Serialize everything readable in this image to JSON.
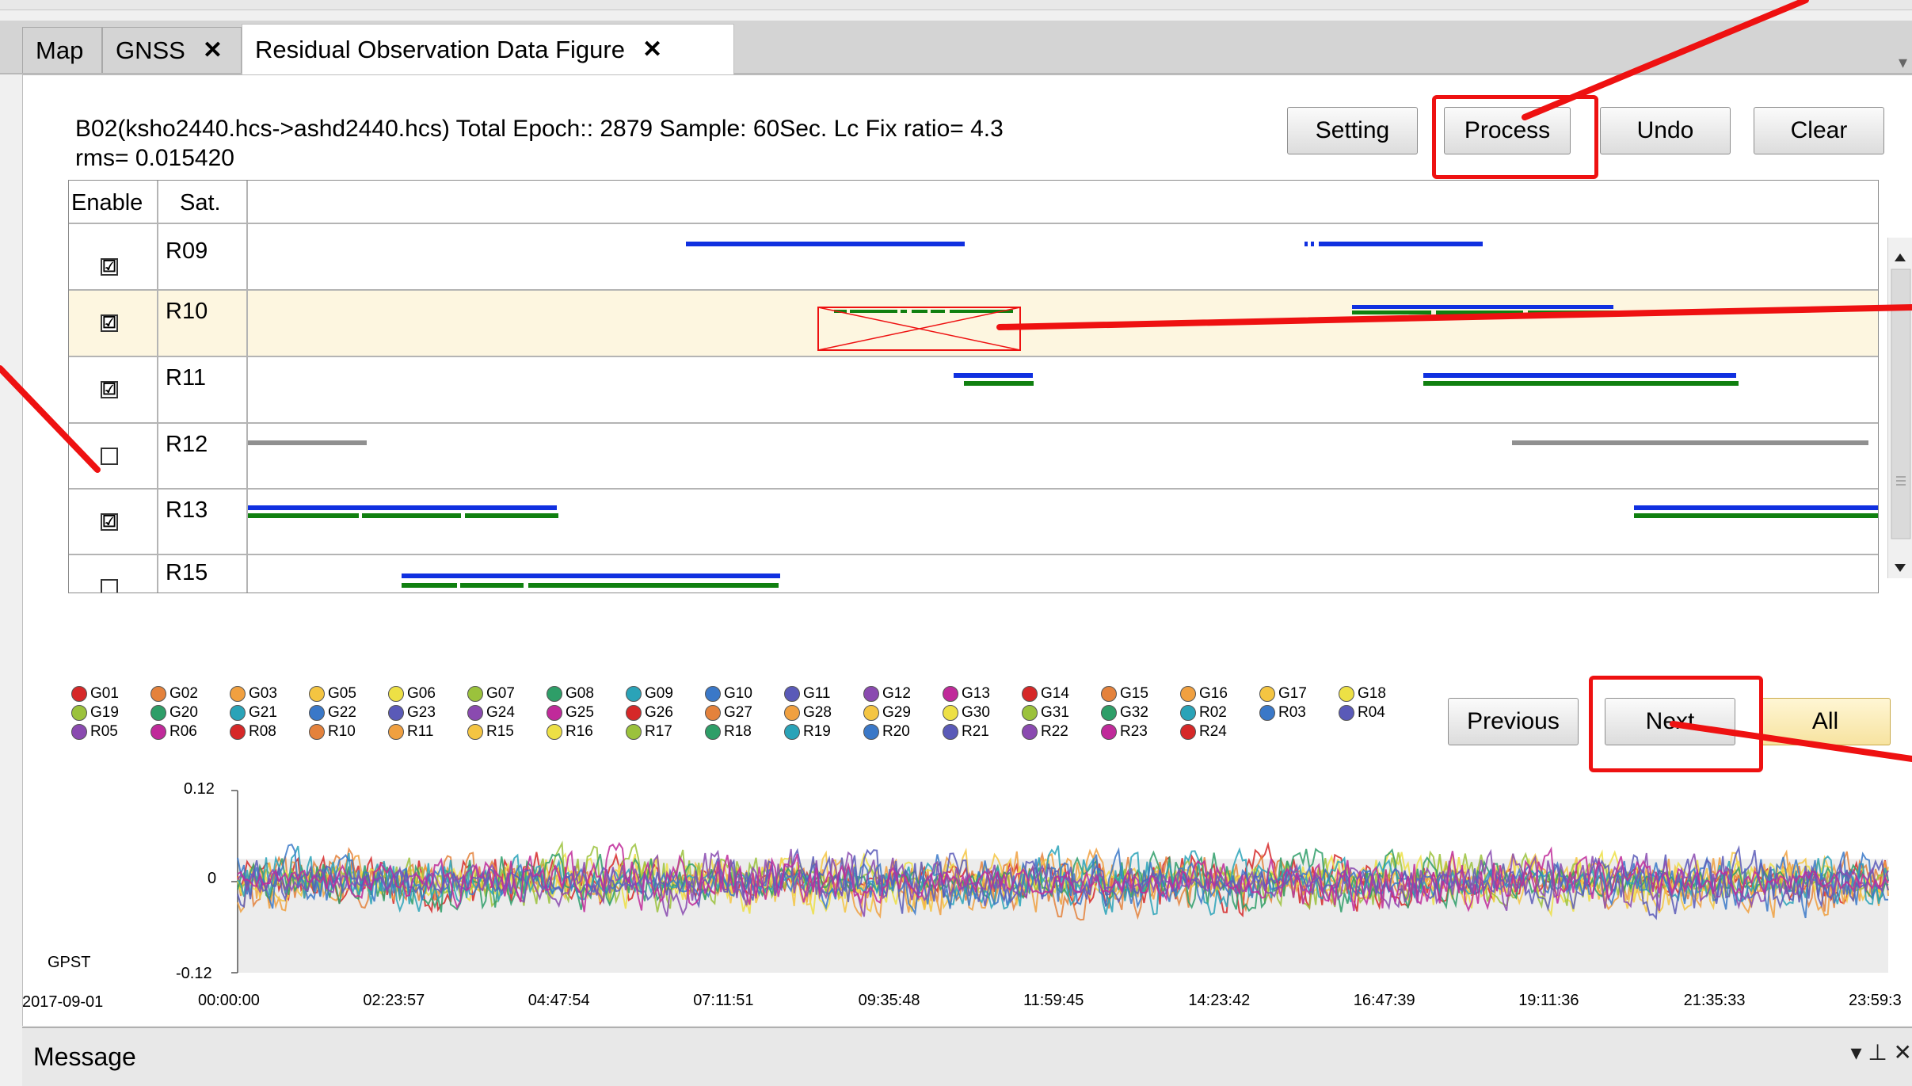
{
  "tabs": [
    {
      "label": "Map",
      "closable": false
    },
    {
      "label": "GNSS",
      "closable": true
    },
    {
      "label": "Residual Observation Data Figure",
      "closable": true
    }
  ],
  "tab_close_glyph": "✕",
  "tab_menu_glyph": "▾",
  "info_line1": "B02(ksho2440.hcs->ashd2440.hcs)   Total Epoch:: 2879   Sample: 60Sec.   Lc Fix   ratio=  4.3",
  "info_line2": "rms=  0.015420",
  "buttons": {
    "setting": "Setting",
    "process": "Process",
    "undo": "Undo",
    "clear": "Clear",
    "previous": "Previous",
    "next": "Next",
    "all": "All"
  },
  "grid": {
    "header_enable": "Enable",
    "header_sat": "Sat.",
    "rows": [
      {
        "sat": "R09",
        "checked": true,
        "highlighted": false
      },
      {
        "sat": "R10",
        "checked": true,
        "highlighted": true
      },
      {
        "sat": "R11",
        "checked": true,
        "highlighted": false
      },
      {
        "sat": "R12",
        "checked": false,
        "highlighted": false
      },
      {
        "sat": "R13",
        "checked": true,
        "highlighted": false
      },
      {
        "sat": "R15",
        "checked": false,
        "highlighted": false
      }
    ],
    "check_glyph": "☑"
  },
  "legend": {
    "rows": [
      [
        {
          "label": "G01",
          "color": "#d62828"
        },
        {
          "label": "G02",
          "color": "#e4823c"
        },
        {
          "label": "G03",
          "color": "#f0a040"
        },
        {
          "label": "G05",
          "color": "#f4c542"
        },
        {
          "label": "G06",
          "color": "#ede045"
        },
        {
          "label": "G07",
          "color": "#9bc23c"
        },
        {
          "label": "G08",
          "color": "#2e9e68"
        },
        {
          "label": "G09",
          "color": "#2aa3b8"
        },
        {
          "label": "G10",
          "color": "#3a78c8"
        },
        {
          "label": "G11",
          "color": "#5a5ab8"
        },
        {
          "label": "G12",
          "color": "#8a4ab0"
        },
        {
          "label": "G13",
          "color": "#c02a9a"
        },
        {
          "label": "G14",
          "color": "#d62828"
        },
        {
          "label": "G15",
          "color": "#e4823c"
        },
        {
          "label": "G16",
          "color": "#f0a040"
        },
        {
          "label": "G17",
          "color": "#f4c542"
        },
        {
          "label": "G18",
          "color": "#ede045"
        }
      ],
      [
        {
          "label": "G19",
          "color": "#9bc23c"
        },
        {
          "label": "G20",
          "color": "#2e9e68"
        },
        {
          "label": "G21",
          "color": "#2aa3b8"
        },
        {
          "label": "G22",
          "color": "#3a78c8"
        },
        {
          "label": "G23",
          "color": "#5a5ab8"
        },
        {
          "label": "G24",
          "color": "#8a4ab0"
        },
        {
          "label": "G25",
          "color": "#c02a9a"
        },
        {
          "label": "G26",
          "color": "#d62828"
        },
        {
          "label": "G27",
          "color": "#e4823c"
        },
        {
          "label": "G28",
          "color": "#f0a040"
        },
        {
          "label": "G29",
          "color": "#f4c542"
        },
        {
          "label": "G30",
          "color": "#ede045"
        },
        {
          "label": "G31",
          "color": "#9bc23c"
        },
        {
          "label": "G32",
          "color": "#2e9e68"
        },
        {
          "label": "R02",
          "color": "#2aa3b8"
        },
        {
          "label": "R03",
          "color": "#3a78c8"
        },
        {
          "label": "R04",
          "color": "#5a5ab8"
        }
      ],
      [
        {
          "label": "R05",
          "color": "#8a4ab0"
        },
        {
          "label": "R06",
          "color": "#c02a9a"
        },
        {
          "label": "R08",
          "color": "#d62828"
        },
        {
          "label": "R10",
          "color": "#e4823c"
        },
        {
          "label": "R11",
          "color": "#f0a040"
        },
        {
          "label": "R15",
          "color": "#f4c542"
        },
        {
          "label": "R16",
          "color": "#ede045"
        },
        {
          "label": "R17",
          "color": "#9bc23c"
        },
        {
          "label": "R18",
          "color": "#2e9e68"
        },
        {
          "label": "R19",
          "color": "#2aa3b8"
        },
        {
          "label": "R20",
          "color": "#3a78c8"
        },
        {
          "label": "R21",
          "color": "#5a5ab8"
        },
        {
          "label": "R22",
          "color": "#8a4ab0"
        },
        {
          "label": "R23",
          "color": "#c02a9a"
        },
        {
          "label": "R24",
          "color": "#d62828"
        }
      ]
    ]
  },
  "chart_data": {
    "type": "line",
    "title": "",
    "xlabel": "GPST",
    "date_label": "2017-09-01",
    "ylabel": "",
    "ylim": [
      -0.12,
      0.12
    ],
    "y_ticks": [
      "0.12",
      "0",
      "-0.12"
    ],
    "x_ticks": [
      "00:00:00",
      "02:23:57",
      "04:47:54",
      "07:11:51",
      "09:35:48",
      "11:59:45",
      "14:23:42",
      "16:47:39",
      "19:11:36",
      "21:35:33",
      "23:59:3"
    ],
    "grid": false,
    "series_colors": [
      "#d62828",
      "#e4823c",
      "#f0a040",
      "#f4c542",
      "#ede045",
      "#9bc23c",
      "#2e9e68",
      "#2aa3b8",
      "#3a78c8",
      "#5a5ab8",
      "#8a4ab0",
      "#c02a9a"
    ],
    "series_count": 12,
    "approx_amplitude": 0.03
  },
  "message_panel": {
    "title": "Message",
    "controls": "▾  ⊥  ✕"
  },
  "colors": {
    "annotation_red": "#ee1111",
    "highlight_row": "#fdf6e0",
    "bar_blue": "#1030e0",
    "bar_green": "#108010",
    "bar_gray": "#909090"
  }
}
